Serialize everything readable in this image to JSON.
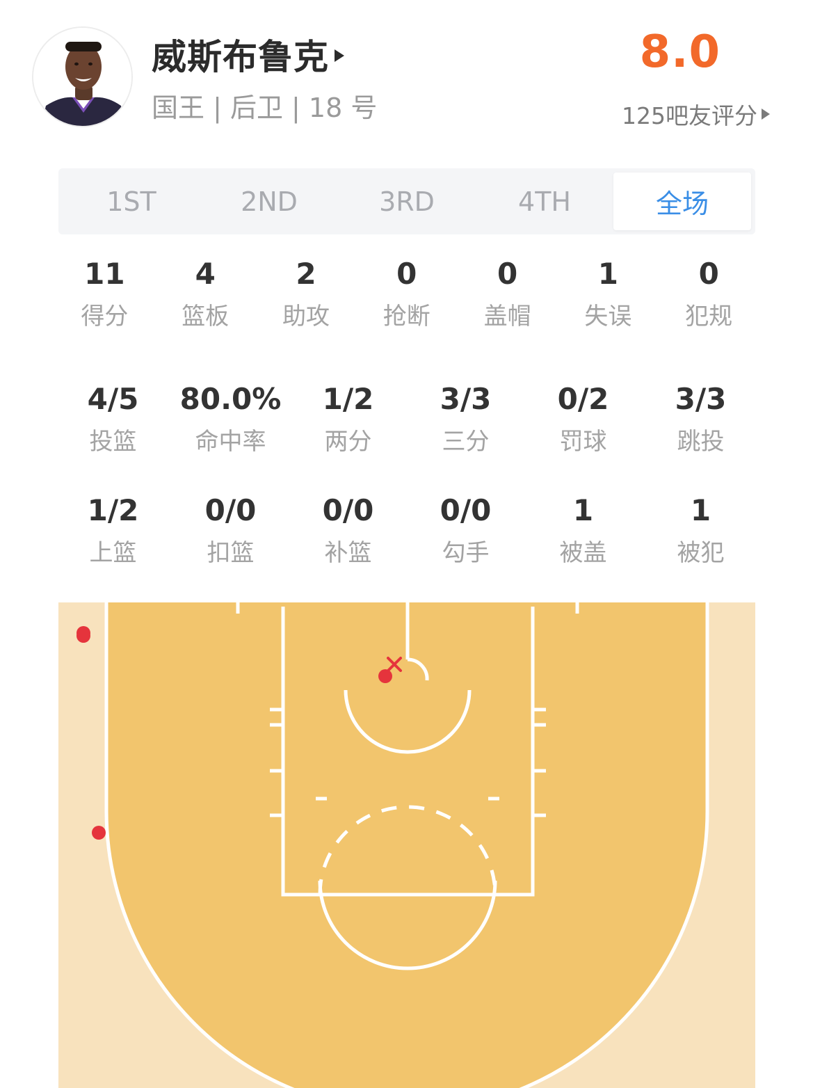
{
  "player": {
    "name": "威斯布鲁克",
    "meta": "国王 | 后卫 | 18 号",
    "avatar_icon": "player-photo-icon"
  },
  "rating": {
    "score": "8.0",
    "count_label": "125吧友评分",
    "color": "#f2692a"
  },
  "tabs": [
    {
      "label": "1ST",
      "active": false
    },
    {
      "label": "2ND",
      "active": false
    },
    {
      "label": "3RD",
      "active": false
    },
    {
      "label": "4TH",
      "active": false
    },
    {
      "label": "全场",
      "active": true
    }
  ],
  "stats_main": [
    {
      "value": "11",
      "label": "得分"
    },
    {
      "value": "4",
      "label": "篮板"
    },
    {
      "value": "2",
      "label": "助攻"
    },
    {
      "value": "0",
      "label": "抢断"
    },
    {
      "value": "0",
      "label": "盖帽"
    },
    {
      "value": "1",
      "label": "失误"
    },
    {
      "value": "0",
      "label": "犯规"
    }
  ],
  "stats_shooting": [
    {
      "value": "4/5",
      "label": "投篮"
    },
    {
      "value": "80.0%",
      "label": "命中率"
    },
    {
      "value": "1/2",
      "label": "两分"
    },
    {
      "value": "3/3",
      "label": "三分"
    },
    {
      "value": "0/2",
      "label": "罚球"
    },
    {
      "value": "3/3",
      "label": "跳投"
    }
  ],
  "stats_detail": [
    {
      "value": "1/2",
      "label": "上篮"
    },
    {
      "value": "0/0",
      "label": "扣篮"
    },
    {
      "value": "0/0",
      "label": "补篮"
    },
    {
      "value": "0/0",
      "label": "勾手"
    },
    {
      "value": "1",
      "label": "被盖"
    },
    {
      "value": "1",
      "label": "被犯"
    }
  ],
  "court": {
    "colors": {
      "outer": "#f8e2bd",
      "inner": "#f2c56d",
      "lines": "#ffffff",
      "made_shot": "#e5343c",
      "missed_shot": "#e5343c"
    },
    "legend_icons": [
      "made-shot-dot-icon",
      "missed-shot-x-icon"
    ]
  }
}
